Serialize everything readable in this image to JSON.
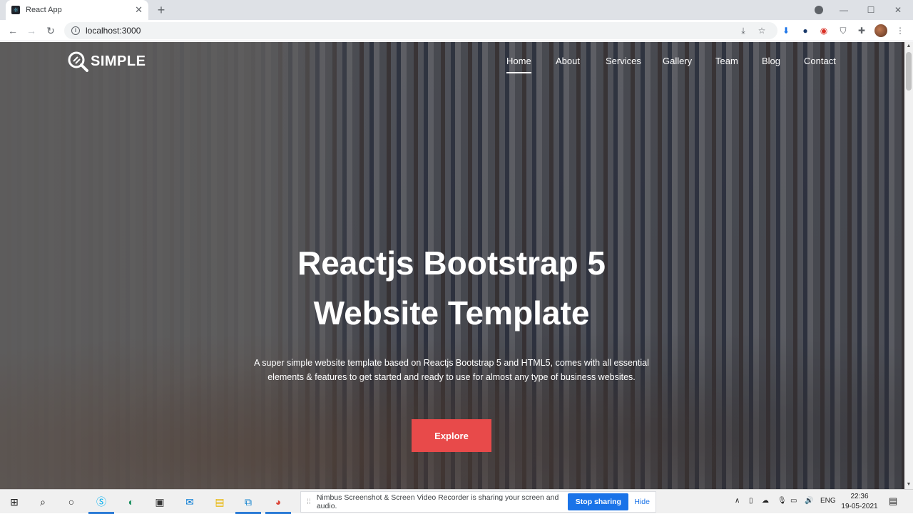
{
  "browser": {
    "tab_title": "React App",
    "tab_close": "✕",
    "new_tab": "+",
    "url": "localhost:3000",
    "window_controls": {
      "minimize": "—",
      "maximize": "☐",
      "close": "✕"
    }
  },
  "site": {
    "logo_text": "SIMPLE",
    "nav": [
      {
        "label": "Home",
        "active": true
      },
      {
        "label": "About"
      },
      {
        "label": "Services"
      },
      {
        "label": "Gallery"
      },
      {
        "label": "Team"
      },
      {
        "label": "Blog"
      },
      {
        "label": "Contact"
      }
    ],
    "hero": {
      "title_line1": "Reactjs Bootstrap 5",
      "title_line2": "Website Template",
      "subtitle": "A super simple website template based on Reactjs Bootstrap 5 and HTML5, comes with all essential elements & features to get started and ready to use for almost any type of business websites.",
      "cta": "Explore"
    }
  },
  "taskbar": {
    "share_message": "Nimbus Screenshot & Screen Video Recorder is sharing your screen and audio.",
    "stop_sharing": "Stop sharing",
    "hide": "Hide",
    "language": "ENG",
    "time": "22:36",
    "date": "19-05-2021"
  },
  "colors": {
    "accent": "#e84a4a",
    "share_button": "#1a73e8",
    "taskbar_active": "#2b7bd6"
  }
}
